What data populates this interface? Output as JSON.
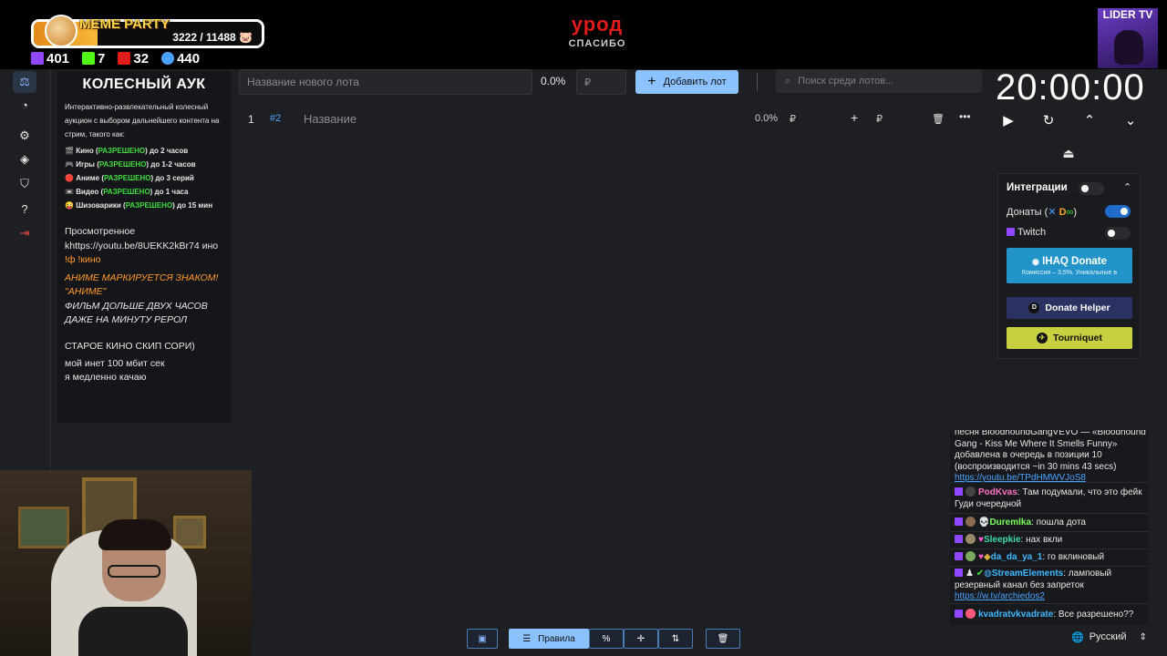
{
  "overlay": {
    "meme_title": "MEME PARTY",
    "meme_count": "3222 / 11488",
    "meme_progress": 0.28,
    "stats": [
      "401",
      "7",
      "32",
      "440"
    ],
    "center_title": "урод",
    "center_subtitle": "СПАСИБО",
    "channel": "LIDER TV"
  },
  "rules": {
    "title": "КОЛЕСНЫЙ АУК",
    "description": "Интерактивно-развлекательный колесный аукцион с выбором дальнейшего контента на стрим, такого как:",
    "items": [
      {
        "icon": "🎬",
        "name": "Кино (",
        "allowed": "РАЗРЕШЕНО",
        "rest": ") до 2 часов"
      },
      {
        "icon": "🎮",
        "name": "Игры (",
        "allowed": "РАЗРЕШЕНО",
        "rest": ") до 1-2 часов"
      },
      {
        "icon": "🔴",
        "name": "Аниме (",
        "allowed": "РАЗРЕШЕНО",
        "rest": ") до 3 серий"
      },
      {
        "icon": "📼",
        "name": "Видео (",
        "allowed": "РАЗРЕШЕНО",
        "rest": ") до 1 часа"
      },
      {
        "icon": "😜",
        "name": "Шизоварики (",
        "allowed": "РАЗРЕШЕНО",
        "rest": ") до 15 мин"
      }
    ],
    "watched_1": "Просмотренное",
    "watched_2": "khttps://youtu.be/8UEKK2kBr74 ино",
    "watched_3": "!ф !кино",
    "anime_1": "АНИМЕ МАРКИРУЕТСЯ ЗНАКОМ!",
    "anime_2": "\"АНИМЕ\"",
    "film_1": "ФИЛЬМ ДОЛЬШЕ ДВУХ ЧАСОВ",
    "film_2": "ДАЖЕ НА МИНУТУ РЕРОЛ",
    "old": "СТАРОЕ КИНО СКИП СОРИ)",
    "net_1": "мой инет 100 мбит сек",
    "net_2": "я медленно качаю"
  },
  "toolbar": {
    "lot_placeholder": "Название нового лота",
    "percent": "0.0%",
    "currency": "₽",
    "add_label": "Добавить лот",
    "search_placeholder": "Поиск среди лотов..."
  },
  "lots": [
    {
      "num": "1",
      "id": "#2",
      "name": "Название",
      "percent": "0.0%",
      "currency": "₽",
      "currency2": "₽"
    }
  ],
  "timer": {
    "value": "20:00:00"
  },
  "integrations": {
    "title": "Интеграции",
    "donates_label": "Донаты (",
    "donates_close": ")",
    "twitch_label": "Twitch",
    "ihaq_title": "IHAQ Donate",
    "ihaq_sub": "Комиссия – 3,5%. Уникальные в",
    "donate_helper": "Donate Helper",
    "tourniquet": "Tourniquet"
  },
  "chat": {
    "msg1_text": "песня BloodhoundGangVEVO — «Bloodhound Gang - Kiss Me Where It Smells Funny» добавлена в очередь в позиции 10 (воспроизводится ~in 30 mins 43 secs)",
    "msg1_link": "https://youtu.be/TPdHMWVJoS8",
    "msg2_user": "PodKvas",
    "msg2_text": "Там подумали, что это фейк Гуди очередной",
    "msg3_user": "Duremlka",
    "msg3_text": "пошла дота",
    "msg4_user": "Sleepkie",
    "msg4_text": "нах вкли",
    "msg5_user": "da_da_ya_1",
    "msg5_text": "го вклиновый",
    "msg6_user": "StreamElements",
    "msg6_text": "ламповый резервный канал без запреток",
    "msg6_link": "https://w.tv/archiedos2",
    "msg7_user": "kvadratvkvadrate",
    "msg7_text": "Все разрешено??",
    "colors": {
      "podkvas": "#ff6fc1",
      "duremlka": "#7bff5a",
      "sleepkie": "#3dd9b3",
      "da_da_ya": "#3fb9ff",
      "streamelements": "#3fb9ff",
      "kvadrat": "#3fb9ff"
    }
  },
  "language": {
    "label": "Русский"
  },
  "bottom": {
    "rules_label": "Правила"
  },
  "colors": {
    "accent": "#8cc2ff",
    "allowed": "#3fdc3f",
    "anime": "#ff9a2a",
    "title_red": "#e01b1b",
    "twitch": "#9146ff"
  }
}
